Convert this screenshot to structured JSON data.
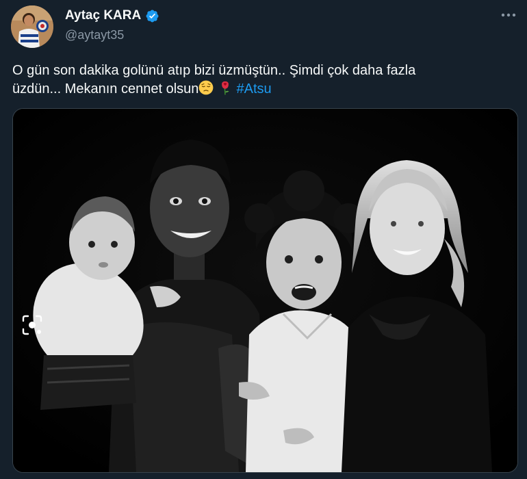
{
  "author": {
    "display_name": "Aytaç KARA",
    "handle": "@aytayt35",
    "verified": true,
    "avatar_icon": "profile-photo"
  },
  "tweet": {
    "text_line1": "O gün son dakika golünü atıp bizi üzmüştün.. Şimdi çok daha fazla",
    "text_line2_prefix": "üzdün... Mekanın cennet olsun",
    "hashtag": "#Atsu",
    "emojis": [
      "pensive-face-emoji",
      "rose-emoji"
    ]
  },
  "media": {
    "description_icon": "family-photo",
    "overlay_icon": "lens-icon"
  },
  "colors": {
    "background": "#15202b",
    "text": "#f7f9f9",
    "muted": "#8b98a5",
    "accent": "#1d9bf0",
    "border": "#38444d"
  }
}
